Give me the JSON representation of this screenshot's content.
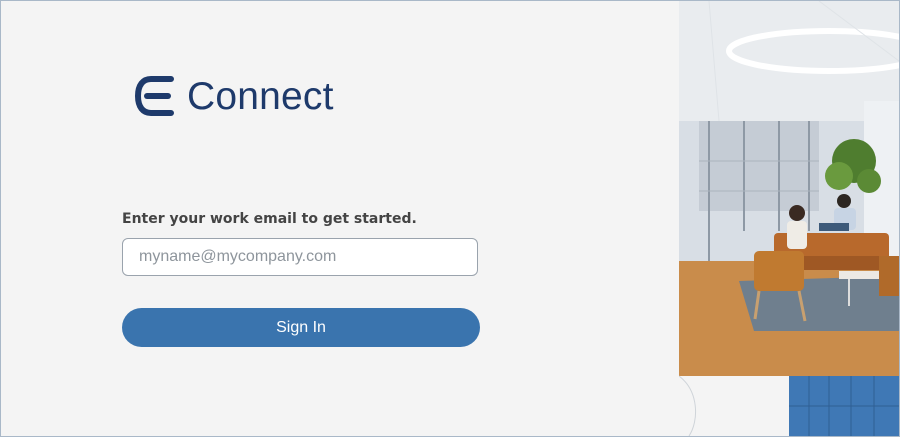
{
  "brand": {
    "name": "Connect",
    "logo_icon": "e-letter-logo-icon",
    "color": "#1e3a6b"
  },
  "login": {
    "prompt": "Enter your work email to get started.",
    "email_placeholder": "myname@mycompany.com",
    "email_value": "",
    "signin_label": "Sign In",
    "button_color": "#3a74ae"
  },
  "hero": {
    "description_icon": "office-lounge-photo"
  }
}
